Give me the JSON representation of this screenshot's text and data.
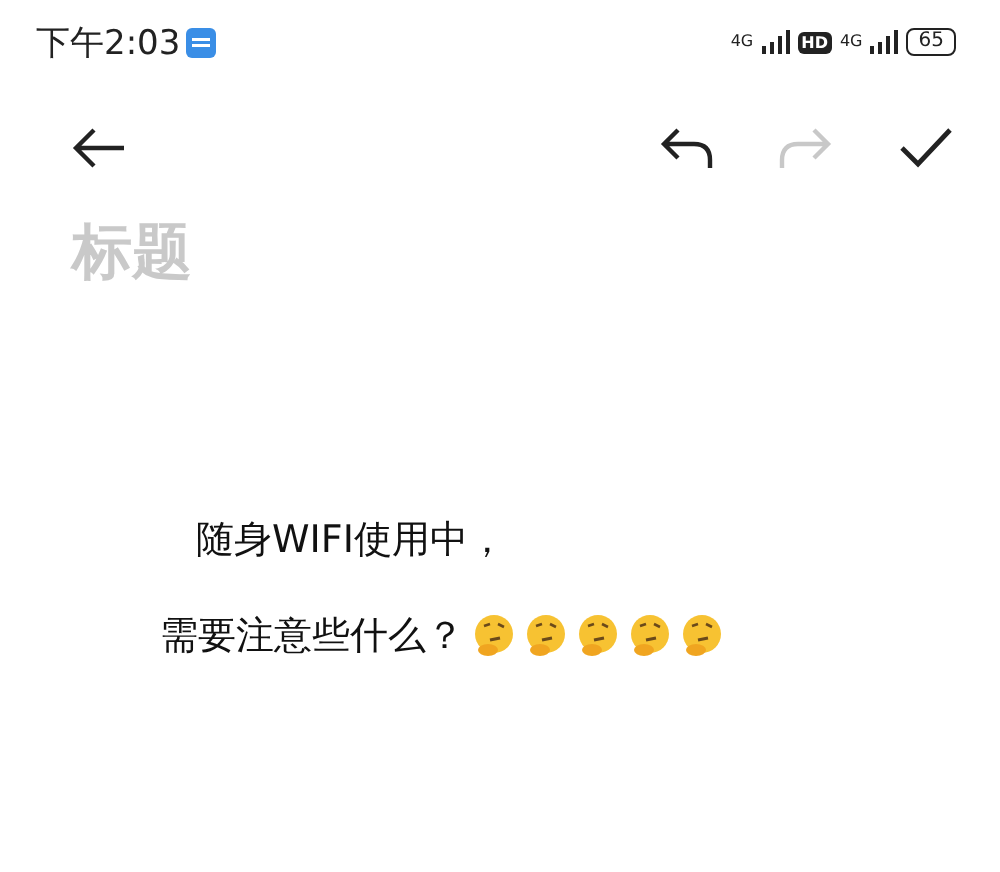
{
  "status_bar": {
    "time": "下午2:03",
    "sim1_label": "4G",
    "hd_label": "HD",
    "sim2_label": "4G",
    "battery": "65"
  },
  "toolbar": {
    "redo_disabled": true
  },
  "title": {
    "placeholder": "标题"
  },
  "paragraphs": [
    {
      "text": "随身WIFI使用中，",
      "indented": true
    },
    {
      "text": "需要注意些什么？",
      "indented": false,
      "emojis": [
        {
          "kind": "thinking"
        },
        {
          "kind": "thinking"
        },
        {
          "kind": "thinking"
        },
        {
          "kind": "thinking"
        },
        {
          "kind": "thinking"
        }
      ]
    }
  ]
}
